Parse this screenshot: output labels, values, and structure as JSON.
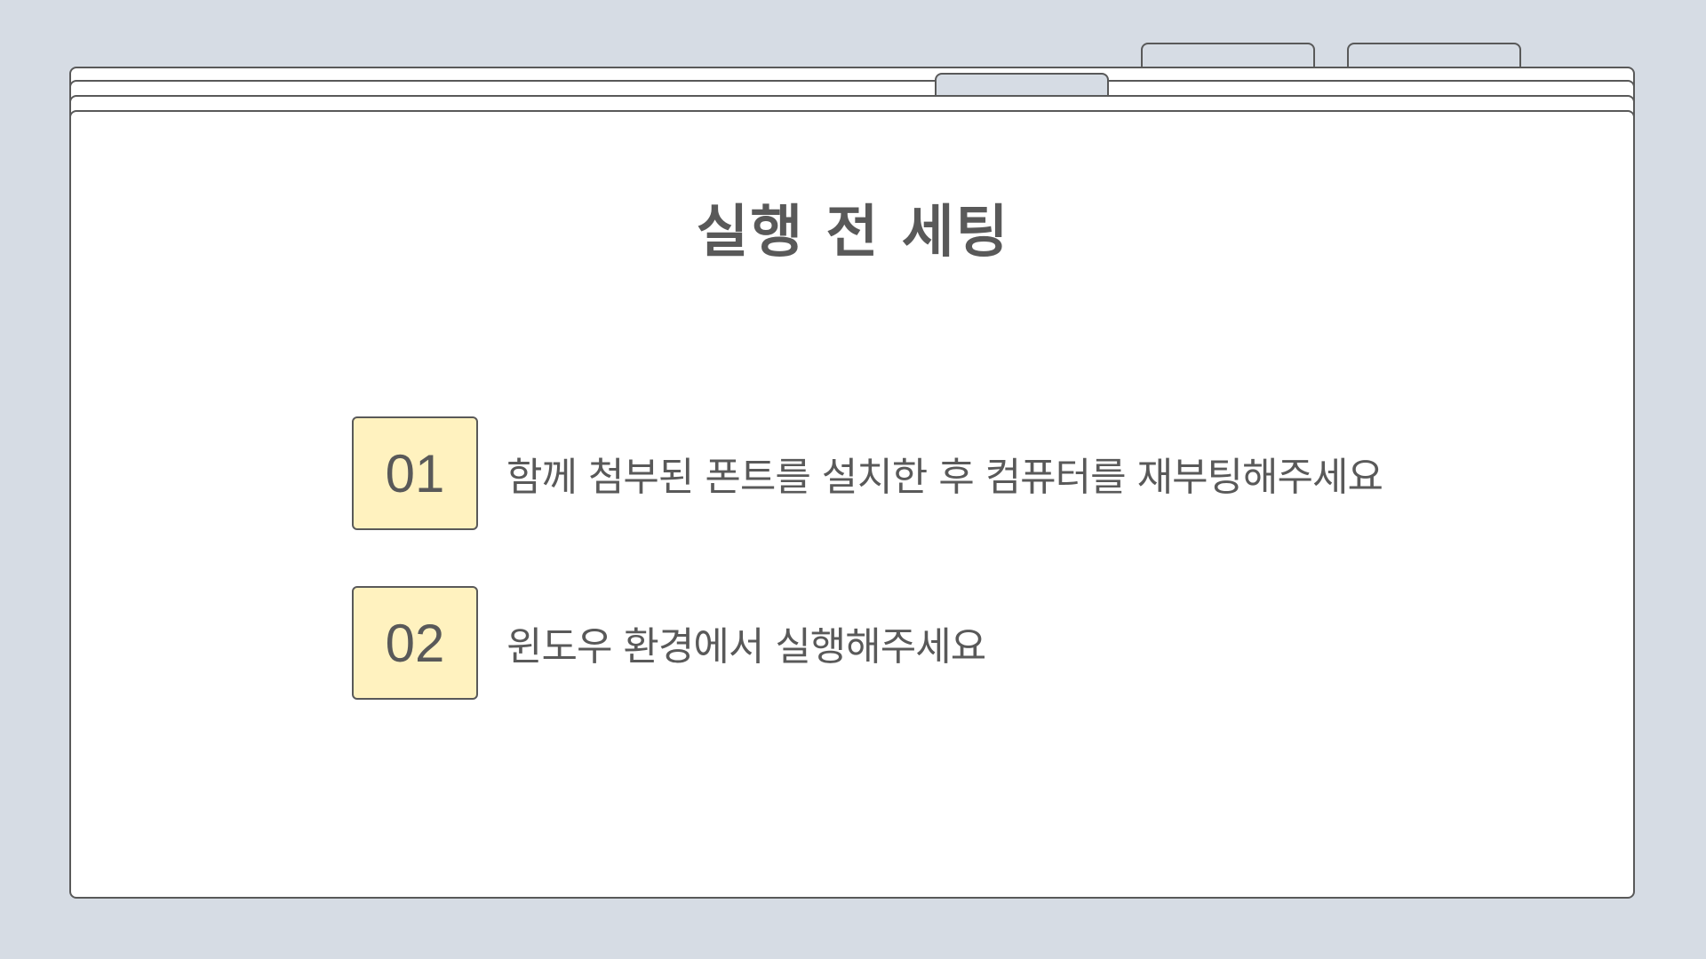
{
  "slide": {
    "title": "실행 전 세팅",
    "items": [
      {
        "number": "01",
        "text": "함께 첨부된 폰트를 설치한 후 컴퓨터를 재부팅해주세요"
      },
      {
        "number": "02",
        "text": "윈도우 환경에서 실행해주세요"
      }
    ]
  },
  "colors": {
    "background": "#d6dce4",
    "sheet": "#ffffff",
    "outline": "#595959",
    "number_box": "#fff2bf",
    "text": "#595959"
  }
}
